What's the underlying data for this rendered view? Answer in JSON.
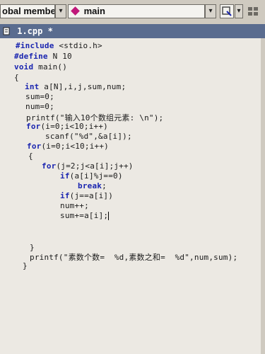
{
  "toolbar": {
    "scope_combo": "obal members",
    "function_combo": "main",
    "dropdown_glyph": "▾"
  },
  "tab": {
    "file_name": "1.cpp *"
  },
  "code": {
    "l1_kw": "#include",
    "l1_rest": " <stdio.h>",
    "l2_kw": "#define",
    "l2_rest": " N 10",
    "l3_kw": "void",
    "l3_rest": " main()",
    "l4": "{",
    "l5_kw": "int",
    "l5_rest": " a[N],i,j,sum,num;",
    "l6": "sum=0;",
    "l7": "num=0;",
    "l8": "printf(\"输入10个数组元素: \\n\");",
    "l9_kw": "for",
    "l9_rest": "(i=0;i<10;i++)",
    "l10": "scanf(\"%d\",&a[i]);",
    "l11_kw": "for",
    "l11_rest": "(i=0;i<10;i++)",
    "l12": "{",
    "l13_kw": "for",
    "l13_rest": "(j=2;j<a[i];j++)",
    "l14_kw": "if",
    "l14_rest": "(a[i]%j==0)",
    "l15_kw": "break",
    "l15_rest": ";",
    "l16_kw": "if",
    "l16_rest": "(j==a[i])",
    "l17": "num++;",
    "l18": "sum+=a[i];",
    "l19": "}",
    "l20": "printf(\"素数个数=  %d,素数之和=  %d\",num,sum);",
    "l21": "}"
  }
}
